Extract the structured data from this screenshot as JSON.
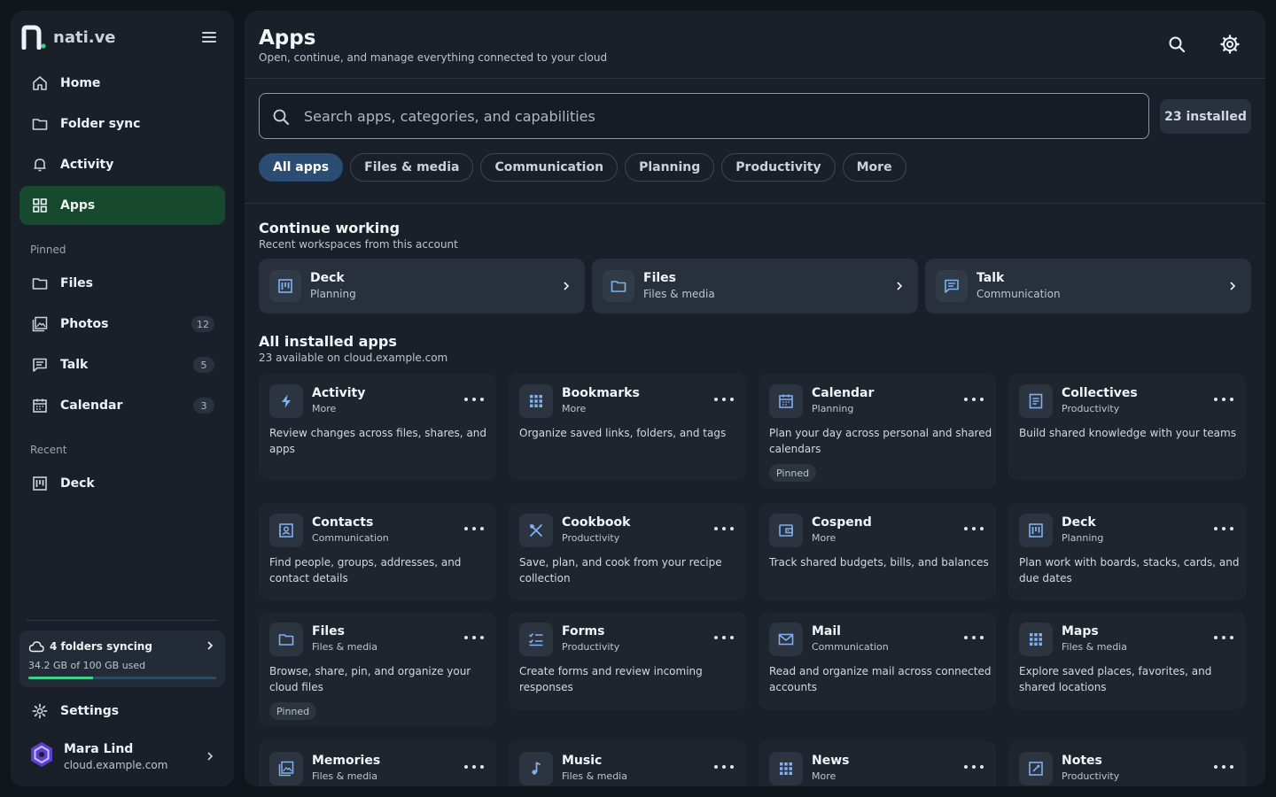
{
  "brand": {
    "name": "nati.ve"
  },
  "sidebar": {
    "nav": [
      {
        "label": "Home",
        "icon": "home-icon"
      },
      {
        "label": "Folder sync",
        "icon": "folder-icon"
      },
      {
        "label": "Activity",
        "icon": "bell-icon"
      },
      {
        "label": "Apps",
        "icon": "grid-icon",
        "active": true
      }
    ],
    "pinned_label": "Pinned",
    "pinned": [
      {
        "label": "Files",
        "icon": "folder-icon"
      },
      {
        "label": "Photos",
        "icon": "photos-icon",
        "count": "12"
      },
      {
        "label": "Talk",
        "icon": "chat-icon",
        "count": "5"
      },
      {
        "label": "Calendar",
        "icon": "calendar-icon",
        "count": "3"
      }
    ],
    "recent_label": "Recent",
    "recent": [
      {
        "label": "Deck",
        "icon": "deck-icon"
      }
    ],
    "sync": {
      "title": "4 folders syncing",
      "usage": "34.2 GB of 100 GB used",
      "progress": 0.342
    },
    "settings_label": "Settings",
    "user": {
      "name": "Mara Lind",
      "host": "cloud.example.com"
    }
  },
  "header": {
    "title": "Apps",
    "subtitle": "Open, continue, and manage everything connected to your cloud"
  },
  "search": {
    "placeholder": "Search apps, categories, and capabilities"
  },
  "installed_badge": "23 installed",
  "filters": [
    "All apps",
    "Files & media",
    "Communication",
    "Planning",
    "Productivity",
    "More"
  ],
  "continue": {
    "title": "Continue working",
    "subtitle": "Recent workspaces from this account",
    "items": [
      {
        "name": "Deck",
        "category": "Planning",
        "icon": "deck-icon"
      },
      {
        "name": "Files",
        "category": "Files & media",
        "icon": "folder-icon"
      },
      {
        "name": "Talk",
        "category": "Communication",
        "icon": "chat-icon"
      }
    ]
  },
  "installed": {
    "title": "All installed apps",
    "subtitle": "23 available on cloud.example.com",
    "apps": [
      {
        "name": "Activity",
        "category": "More",
        "desc": "Review changes across files, shares, and apps",
        "icon": "bolt-icon"
      },
      {
        "name": "Bookmarks",
        "category": "More",
        "desc": "Organize saved links, folders, and tags",
        "icon": "grid-dots-icon"
      },
      {
        "name": "Calendar",
        "category": "Planning",
        "desc": "Plan your day across personal and shared calendars",
        "icon": "calendar-icon",
        "badge": "Pinned"
      },
      {
        "name": "Collectives",
        "category": "Productivity",
        "desc": "Build shared knowledge with your teams",
        "icon": "document-icon"
      },
      {
        "name": "Contacts",
        "category": "Communication",
        "desc": "Find people, groups, addresses, and contact details",
        "icon": "contacts-icon"
      },
      {
        "name": "Cookbook",
        "category": "Productivity",
        "desc": "Save, plan, and cook from your recipe collection",
        "icon": "utensils-icon"
      },
      {
        "name": "Cospend",
        "category": "More",
        "desc": "Track shared budgets, bills, and balances",
        "icon": "wallet-icon"
      },
      {
        "name": "Deck",
        "category": "Planning",
        "desc": "Plan work with boards, stacks, cards, and due dates",
        "icon": "deck-icon"
      },
      {
        "name": "Files",
        "category": "Files & media",
        "desc": "Browse, share, pin, and organize your cloud files",
        "icon": "folder-icon",
        "badge": "Pinned"
      },
      {
        "name": "Forms",
        "category": "Productivity",
        "desc": "Create forms and review incoming responses",
        "icon": "checklist-icon"
      },
      {
        "name": "Mail",
        "category": "Communication",
        "desc": "Read and organize mail across connected accounts",
        "icon": "mail-icon"
      },
      {
        "name": "Maps",
        "category": "Files & media",
        "desc": "Explore saved places, favorites, and shared locations",
        "icon": "grid-dots-icon"
      },
      {
        "name": "Memories",
        "category": "Files & media",
        "desc": "",
        "icon": "photos-icon"
      },
      {
        "name": "Music",
        "category": "Files & media",
        "desc": "",
        "icon": "music-icon"
      },
      {
        "name": "News",
        "category": "More",
        "desc": "",
        "icon": "grid-dots-icon"
      },
      {
        "name": "Notes",
        "category": "Productivity",
        "desc": "",
        "icon": "notes-icon"
      }
    ]
  },
  "colors": {
    "accent": "#17492f",
    "chip_active": "#2c4d73",
    "icon_blue": "#7fb0ef",
    "progress": "#3fd08a"
  }
}
